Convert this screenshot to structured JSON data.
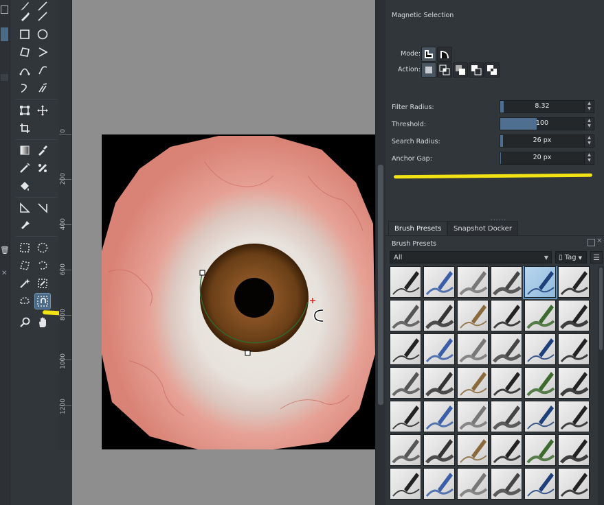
{
  "tool_options": {
    "title": "Magnetic Selection",
    "mode_label": "Mode:",
    "action_label": "Action:",
    "params": [
      {
        "label": "Filter Radius:",
        "value": "8.32",
        "fill": 0.04
      },
      {
        "label": "Threshold:",
        "value": "100",
        "fill": 0.39
      },
      {
        "label": "Search Radius:",
        "value": "26 px",
        "fill": 0.03
      },
      {
        "label": "Anchor Gap:",
        "value": "20 px",
        "fill": 0.01
      }
    ]
  },
  "dockers": {
    "tabs": [
      "Brush Presets",
      "Snapshot Docker"
    ],
    "active_tab": "Brush Presets",
    "panel_title": "Brush Presets",
    "filter_value": "All",
    "tag_label": "Tag"
  },
  "ruler": {
    "labels": [
      "0",
      "200",
      "400",
      "600",
      "800",
      "1000",
      "1200"
    ]
  },
  "colors": {
    "accent": "#4e6f8f",
    "highlight_marker": "#f3e214",
    "sclera_vein": "#e2877e",
    "iris": "#7a4a1e"
  },
  "icons": {
    "toolbox": [
      "freehand-brush-icon",
      "line-icon",
      "rectangle-icon",
      "ellipse-icon",
      "polygon-icon",
      "polyline-icon",
      "bezier-curve-icon",
      "freehand-path-icon",
      "dynamic-brush-icon",
      "multibrush-icon",
      "transform-icon",
      "move-icon",
      "crop-icon",
      "gradient-icon",
      "color-picker-icon",
      "smart-patch-icon",
      "fill-icon",
      "assistant-icon",
      "measure-icon",
      "reference-icon",
      "rectangular-selection-icon",
      "elliptical-selection-icon",
      "polygonal-selection-icon",
      "freehand-selection-icon",
      "contiguous-selection-icon",
      "similar-color-selection-icon",
      "bezier-selection-icon",
      "magnetic-selection-icon",
      "zoom-icon",
      "pan-icon"
    ]
  }
}
